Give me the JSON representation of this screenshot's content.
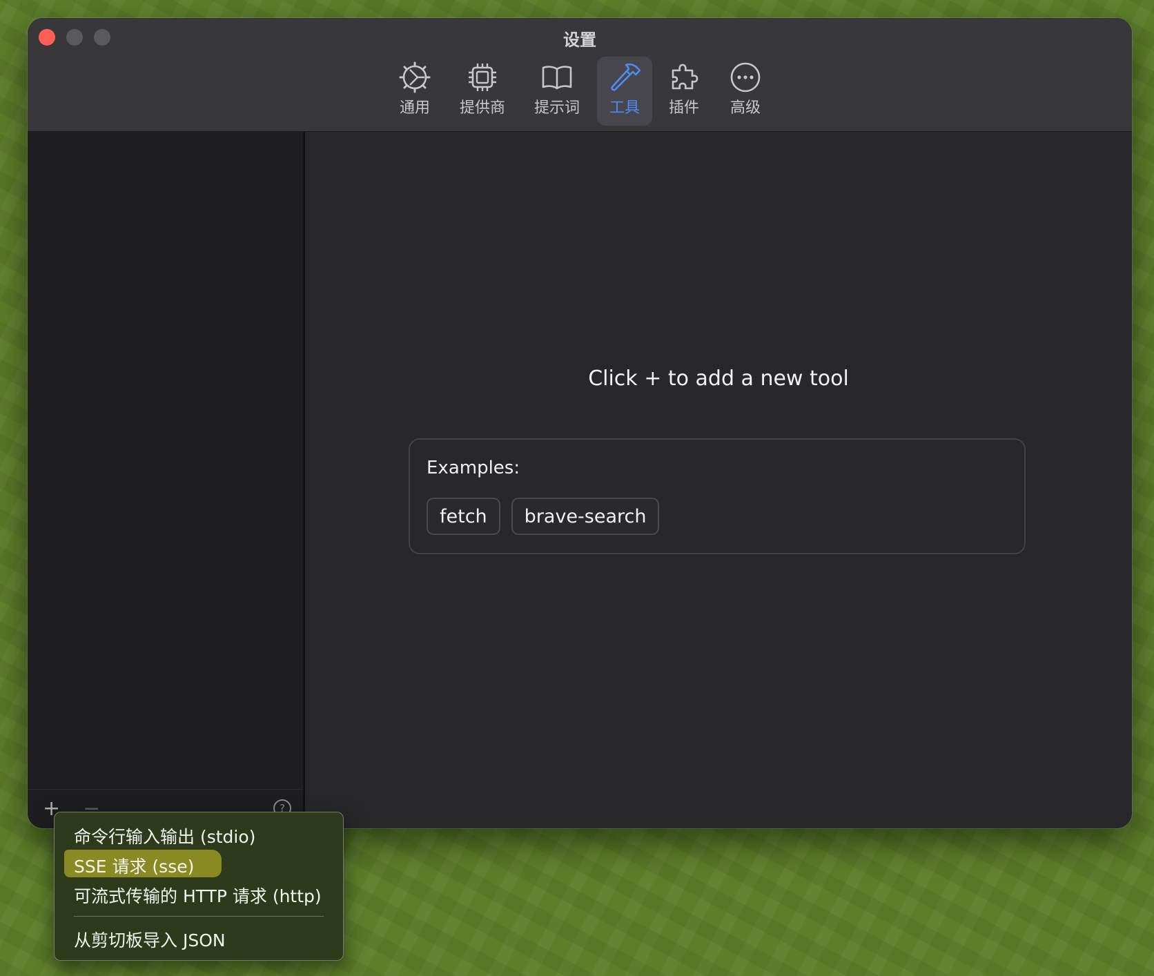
{
  "window": {
    "title": "设置"
  },
  "toolbar": {
    "tabs": [
      {
        "label": "通用",
        "icon": "gear-icon",
        "active": false
      },
      {
        "label": "提供商",
        "icon": "chip-icon",
        "active": false
      },
      {
        "label": "提示词",
        "icon": "book-icon",
        "active": false
      },
      {
        "label": "工具",
        "icon": "hammer-icon",
        "active": true
      },
      {
        "label": "插件",
        "icon": "puzzle-icon",
        "active": false
      },
      {
        "label": "高级",
        "icon": "ellipsis-circle-icon",
        "active": false
      }
    ]
  },
  "sidebar": {
    "add_button": "+",
    "remove_button": "−",
    "help_button": "?"
  },
  "main": {
    "hint": "Click + to add a new tool",
    "examples_label": "Examples:",
    "examples": [
      "fetch",
      "brave-search"
    ]
  },
  "menu": {
    "items": [
      {
        "label": "命令行输入输出 (stdio)",
        "highlighted": false
      },
      {
        "label": "SSE 请求 (sse)",
        "highlighted": true
      },
      {
        "label": "可流式传输的 HTTP 请求 (http)",
        "highlighted": false
      },
      {
        "label": "从剪切板导入 JSON",
        "highlighted": false
      }
    ]
  },
  "colors": {
    "accent": "#4f8cf4",
    "close": "#ff5f57",
    "menu_highlight": "#8a8a22"
  }
}
